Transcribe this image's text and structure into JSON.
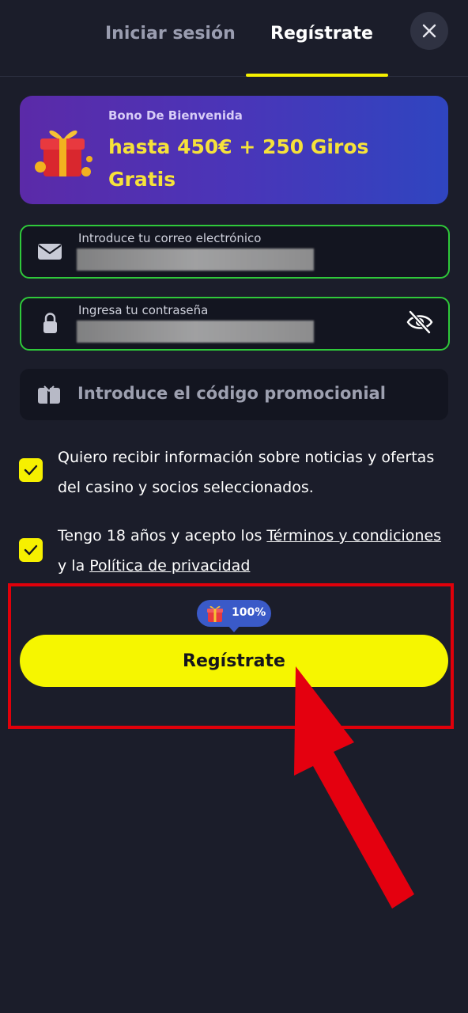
{
  "tabs": {
    "login": "Iniciar sesión",
    "register": "Regístrate"
  },
  "bonus": {
    "subtitle": "Bono De Bienvenida",
    "title": "hasta 450€ + 250 Giros Gratis"
  },
  "email_field": {
    "label": "Introduce tu correo electrónico",
    "value": ""
  },
  "password_field": {
    "label": "Ingresa tu contraseña",
    "value": ""
  },
  "promo": {
    "placeholder": "Introduce el código promocionial"
  },
  "consent": {
    "marketing": "Quiero recibir información sobre noticias y ofertas del casino y socios seleccionados.",
    "age_prefix": "Tengo 18 años y acepto los ",
    "terms": "Términos y condiciones",
    "middle": " y la ",
    "privacy": "Política de privacidad"
  },
  "register_button": {
    "label": "Regístrate",
    "badge": "100%"
  },
  "icons": {
    "close": "close-icon",
    "email": "envelope-icon",
    "lock": "lock-icon",
    "eye": "eye-off-icon",
    "promo": "ticket-icon",
    "gift": "gift-icon"
  },
  "colors": {
    "accent": "#f6f000",
    "valid_border": "#2fc93a",
    "background": "#1b1d2a",
    "annotation": "#e0000a"
  }
}
